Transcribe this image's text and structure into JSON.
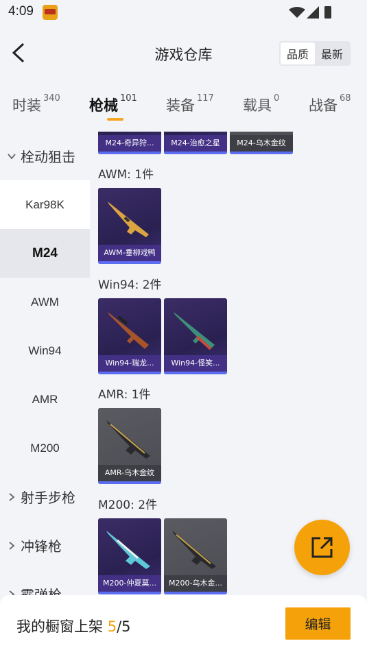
{
  "status": {
    "time": "4:09"
  },
  "header": {
    "title": "游戏仓库",
    "sort_options": [
      "品质",
      "最新"
    ],
    "sort_active": "品质"
  },
  "tabs": [
    {
      "label": "时装",
      "count": "340"
    },
    {
      "label": "枪械",
      "count": "101"
    },
    {
      "label": "装备",
      "count": "117"
    },
    {
      "label": "载具",
      "count": "0"
    },
    {
      "label": "战备",
      "count": "68"
    }
  ],
  "sidebar": {
    "group_sniper": "栓动狙击",
    "items": [
      "Kar98K",
      "M24",
      "AWM",
      "Win94",
      "AMR",
      "M200"
    ],
    "group_marksman": "射手步枪",
    "group_smg": "冲锋枪",
    "group_shotgun": "霰弹枪"
  },
  "content": {
    "top_cards": [
      "M24-奇异狩...",
      "M24-治愈之星",
      "M24-乌木金纹"
    ],
    "sections": [
      {
        "label": "AWM: 1件",
        "cards": [
          "AWM-垂柳戏鸭"
        ]
      },
      {
        "label": "Win94: 2件",
        "cards": [
          "Win94-瑞龙...",
          "Win94-怪笑..."
        ]
      },
      {
        "label": "AMR: 1件",
        "cards": [
          "AMR-乌木金纹"
        ]
      },
      {
        "label": "M200: 2件",
        "cards": [
          "M200-仲夏莫...",
          "M200-乌木金..."
        ]
      }
    ]
  },
  "footer": {
    "showcase_label": "我的橱窗上架",
    "showcase_current": "5",
    "showcase_total": "/5",
    "edit_label": "编辑"
  },
  "colors": {
    "accent": "#f5a20a",
    "card_purple": "#2a2151",
    "card_gray": "#4b4b52",
    "rarity_bar": "#5b6df0"
  }
}
